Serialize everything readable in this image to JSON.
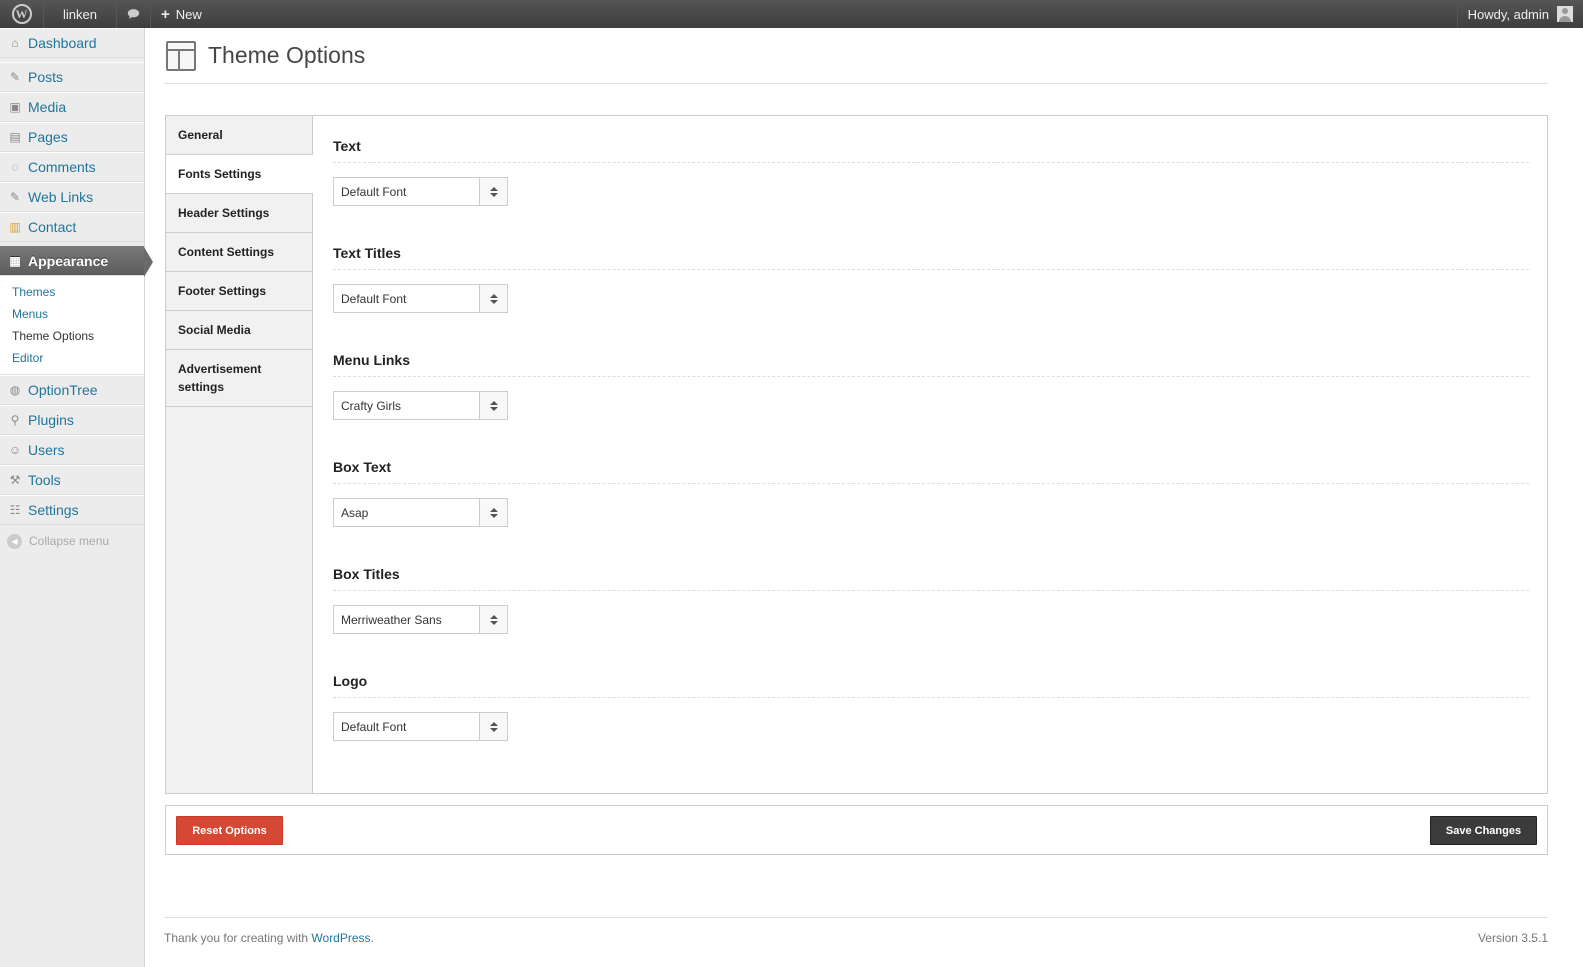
{
  "adminbar": {
    "site_name": "linken",
    "comments_icon": "comment-bubble-icon",
    "new_label": "New",
    "howdy": "Howdy, admin"
  },
  "sidebar": {
    "items": [
      {
        "label": "Dashboard",
        "icon": "house-icon"
      },
      {
        "label": "Posts",
        "icon": "pushpin-icon"
      },
      {
        "label": "Media",
        "icon": "media-icon"
      },
      {
        "label": "Pages",
        "icon": "pages-icon"
      },
      {
        "label": "Comments",
        "icon": "comment-icon"
      },
      {
        "label": "Web Links",
        "icon": "pushpin-icon"
      },
      {
        "label": "Contact",
        "icon": "contact-icon"
      },
      {
        "label": "Appearance",
        "icon": "appearance-icon"
      },
      {
        "label": "OptionTree",
        "icon": "optiontree-icon"
      },
      {
        "label": "Plugins",
        "icon": "plug-icon"
      },
      {
        "label": "Users",
        "icon": "users-icon"
      },
      {
        "label": "Tools",
        "icon": "tools-icon"
      },
      {
        "label": "Settings",
        "icon": "settings-icon"
      }
    ],
    "submenu": [
      "Themes",
      "Menus",
      "Theme Options",
      "Editor"
    ],
    "collapse": "Collapse menu"
  },
  "page": {
    "title": "Theme Options"
  },
  "tabs": [
    "General",
    "Fonts Settings",
    "Header Settings",
    "Content Settings",
    "Footer Settings",
    "Social Media",
    "Advertisement settings"
  ],
  "options": [
    {
      "title": "Text",
      "value": "Default Font"
    },
    {
      "title": "Text Titles",
      "value": "Default Font"
    },
    {
      "title": "Menu Links",
      "value": "Crafty Girls"
    },
    {
      "title": "Box Text",
      "value": "Asap"
    },
    {
      "title": "Box Titles",
      "value": "Merriweather Sans"
    },
    {
      "title": "Logo",
      "value": "Default Font"
    }
  ],
  "actions": {
    "reset": "Reset Options",
    "save": "Save Changes"
  },
  "footer": {
    "thanks": "Thank you for creating with ",
    "wp_link": "WordPress",
    "period": ".",
    "version": "Version 3.5.1"
  },
  "colors": {
    "reset_button": "#d54833",
    "save_button": "#3b3b3b",
    "link": "#21759b"
  }
}
